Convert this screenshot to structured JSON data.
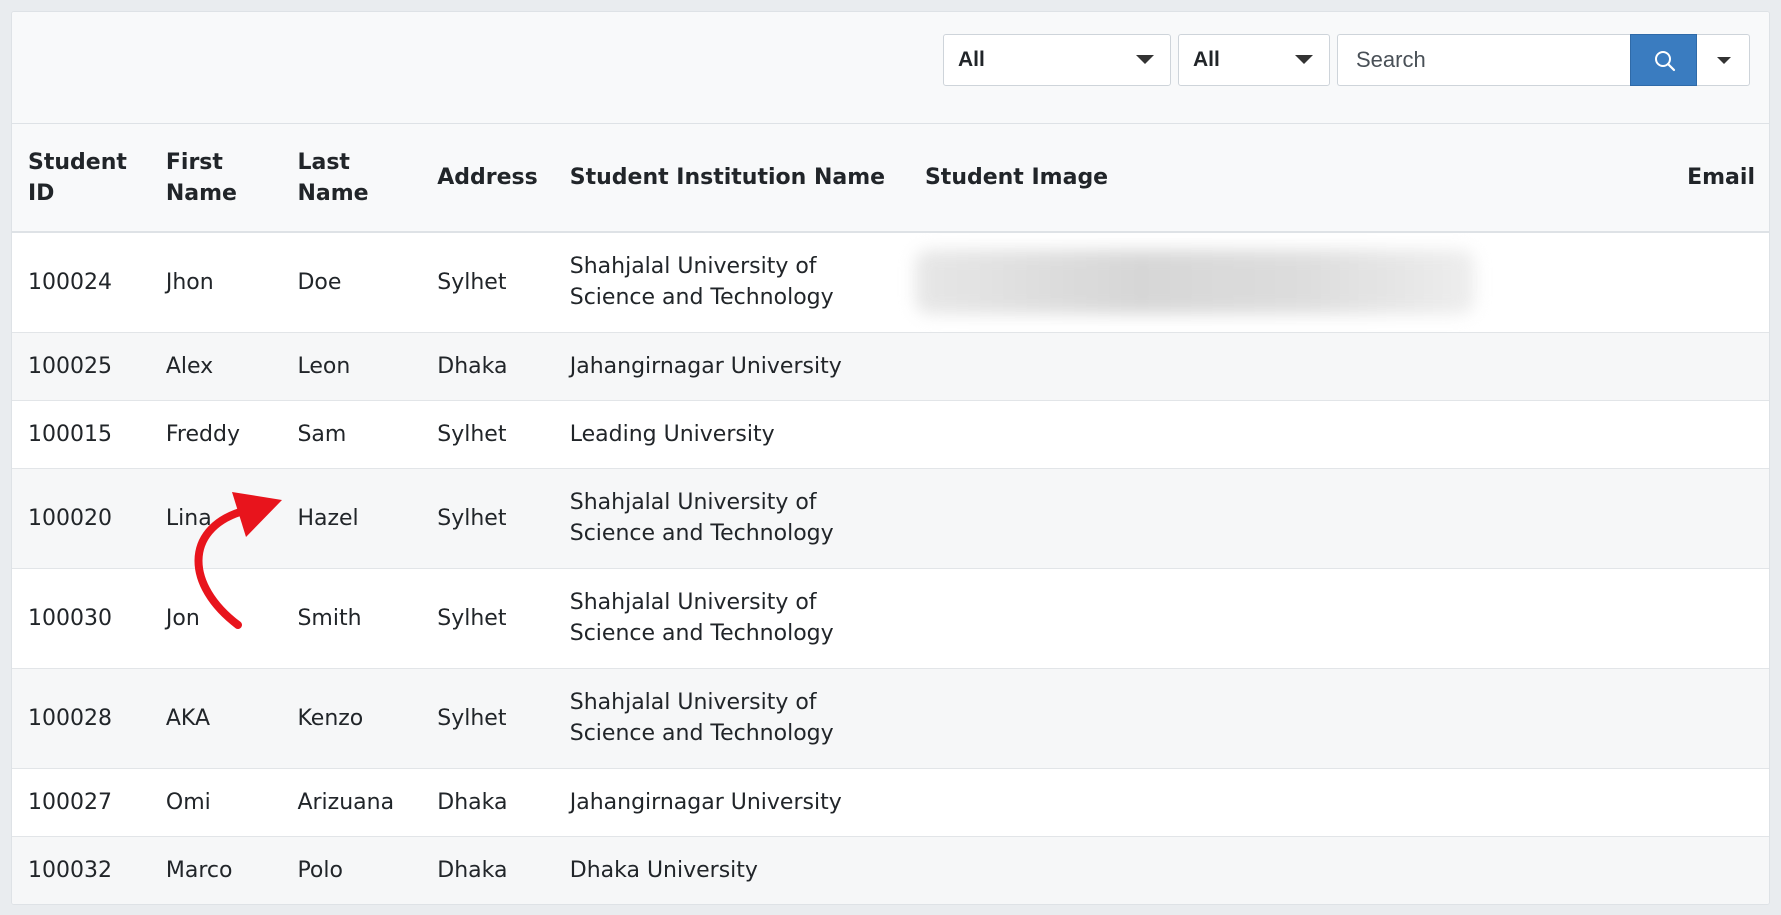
{
  "toolbar": {
    "filter1": "All",
    "filter2": "All",
    "search_placeholder": "Search"
  },
  "table": {
    "headers": {
      "id": "Student ID",
      "first": "First Name",
      "last": "Last Name",
      "address": "Address",
      "institution": "Student Institution Name",
      "image": "Student Image",
      "email": "Email"
    },
    "rows": [
      {
        "id": "100024",
        "first": "Jhon",
        "last": "Doe",
        "address": "Sylhet",
        "institution": "Shahjalal University of Science and Technology"
      },
      {
        "id": "100025",
        "first": "Alex",
        "last": "Leon",
        "address": "Dhaka",
        "institution": "Jahangirnagar University"
      },
      {
        "id": "100015",
        "first": "Freddy",
        "last": "Sam",
        "address": "Sylhet",
        "institution": "Leading University"
      },
      {
        "id": "100020",
        "first": "Lina",
        "last": "Hazel",
        "address": "Sylhet",
        "institution": "Shahjalal University of Science and Technology"
      },
      {
        "id": "100030",
        "first": "Jon",
        "last": "Smith",
        "address": "Sylhet",
        "institution": "Shahjalal University of Science and Technology"
      },
      {
        "id": "100028",
        "first": "AKA",
        "last": "Kenzo",
        "address": "Sylhet",
        "institution": "Shahjalal University of Science and Technology"
      },
      {
        "id": "100027",
        "first": "Omi",
        "last": "Arizuana",
        "address": "Dhaka",
        "institution": "Jahangirnagar University"
      },
      {
        "id": "100032",
        "first": "Marco",
        "last": "Polo",
        "address": "Dhaka",
        "institution": "Dhaka University"
      }
    ]
  },
  "colors": {
    "highlight": "#ff8502",
    "arrow": "#e8141c",
    "search_button": "#3a7cc0"
  }
}
